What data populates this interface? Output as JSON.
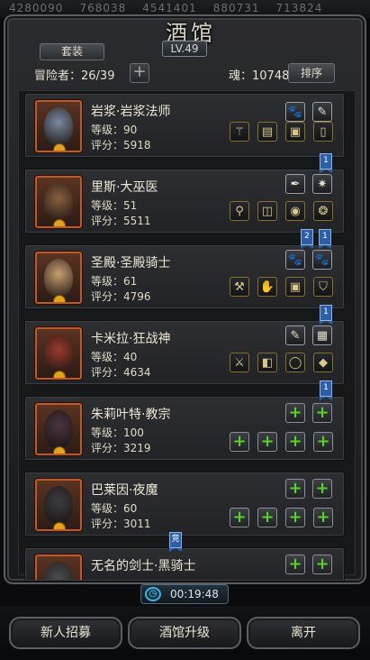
{
  "top_strip": [
    "4280090",
    "768038",
    "4541401",
    "880731",
    "713824"
  ],
  "header": {
    "title": "酒馆",
    "level": "LV.49",
    "suit_button": "套装",
    "adventurer_count": "冒险者：26/39",
    "add_symbol": "+",
    "soul": "魂：10748",
    "sort_button": "排序"
  },
  "heroes": [
    {
      "name": "岩浆·岩浆法师",
      "level": "等级：90",
      "score": "评分：5918",
      "skills": [
        "paw-icon",
        "feather-icon"
      ],
      "equips": [
        "staff-icon",
        "tome-icon",
        "armor-icon",
        "boots-icon"
      ]
    },
    {
      "name": "里斯·大巫医",
      "level": "等级：51",
      "score": "评分：5511",
      "skills": [
        "dark-feather-icon",
        "star-burst-icon"
      ],
      "equips": [
        "wand-icon",
        "bracer-icon",
        "orb-icon",
        "amulet-icon"
      ]
    },
    {
      "name": "圣殿·圣殿骑士",
      "level": "等级：61",
      "score": "评分：4796",
      "skills": [
        "paw-icon",
        "paw-icon"
      ],
      "equips": [
        "hammer-icon",
        "gauntlet-icon",
        "armor-icon",
        "cape-icon"
      ]
    },
    {
      "name": "卡米拉·狂战神",
      "level": "等级：40",
      "score": "评分：4634",
      "skills": [
        "feather-icon",
        "card-icon"
      ],
      "equips": [
        "axe-icon",
        "gloves-icon",
        "ring-icon",
        "gem-icon"
      ]
    },
    {
      "name": "朱莉叶特·教宗",
      "level": "等级：100",
      "score": "评分：3219",
      "skills": [
        "empty",
        "empty"
      ],
      "equips": [
        "empty",
        "empty",
        "empty",
        "empty"
      ]
    },
    {
      "name": "巴莱因·夜魔",
      "level": "等级：60",
      "score": "评分：3011",
      "skills": [
        "empty",
        "empty"
      ],
      "equips": [
        "empty",
        "empty",
        "empty",
        "empty"
      ]
    },
    {
      "name": "无名的剑士·黑骑士",
      "level": "",
      "score": "",
      "skills": [
        "empty",
        "empty"
      ],
      "equips": []
    }
  ],
  "tags": [
    "1",
    "2",
    "1",
    "1",
    "1",
    "竞"
  ],
  "timer": "00:19:48",
  "footer": {
    "recruit": "新人招募",
    "upgrade": "酒馆升级",
    "leave": "离开"
  },
  "colors": {
    "accent_orange": "#c05a25",
    "empty_slot_plus": "#58d12c",
    "tag_blue": "#2c5fa8"
  }
}
